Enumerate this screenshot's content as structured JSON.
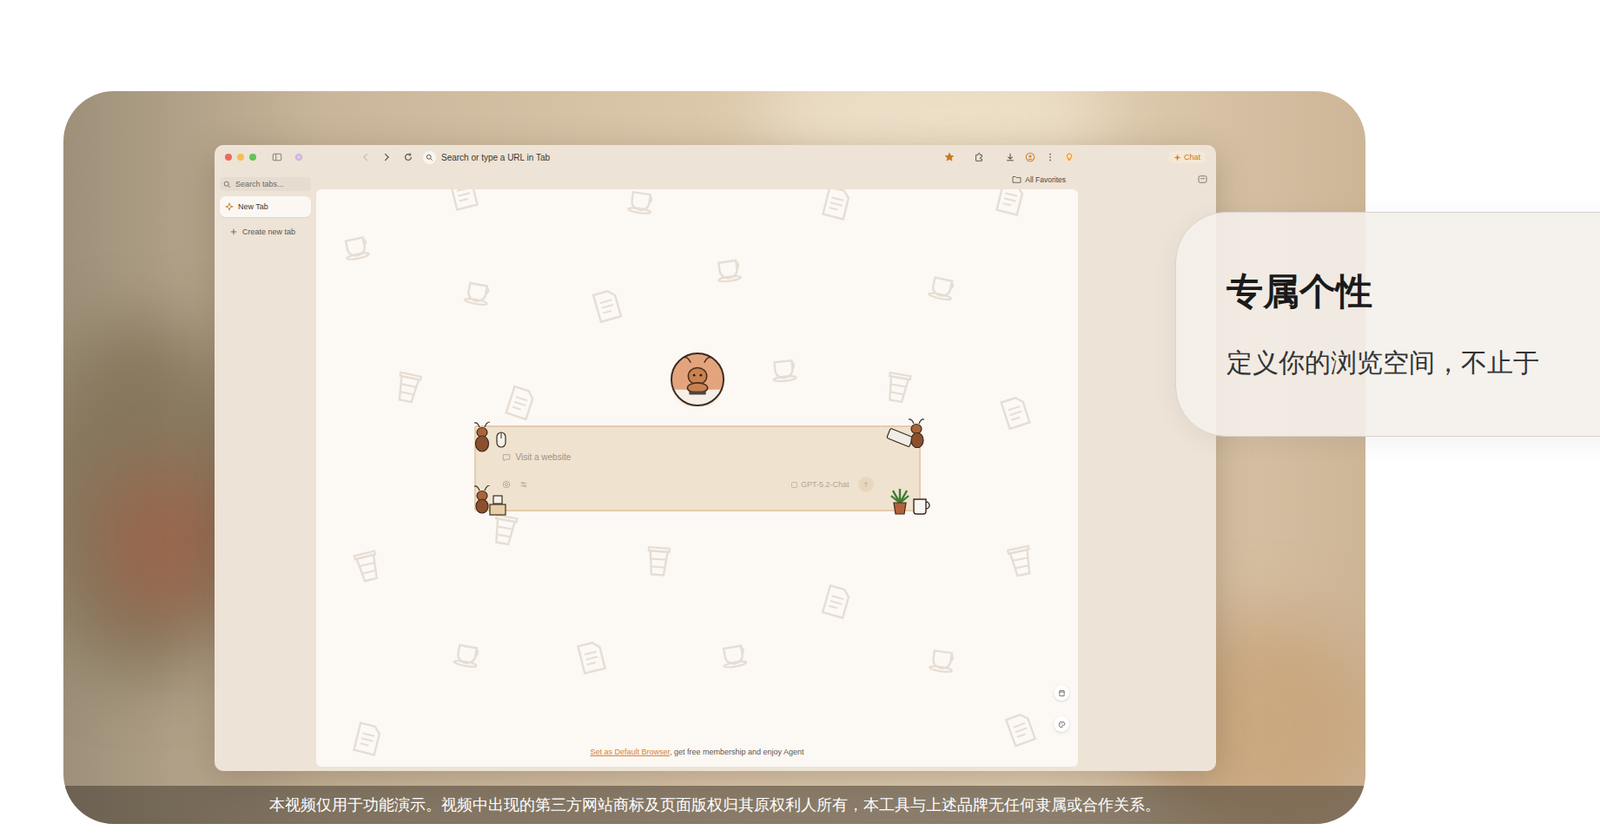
{
  "feature_card": {
    "title": "专属个性",
    "subtitle": "定义你的浏览空间，不止于"
  },
  "caption": "本视频仅用于功能演示。视频中出现的第三方网站商标及页面版权归其原权利人所有，本工具与上述品牌无任何隶属或合作关系。",
  "browser": {
    "address_placeholder": "Search or type a URL in Tab",
    "starred": true,
    "chat_button": "Chat",
    "favorites": "All Favorites",
    "sidebar": {
      "search_placeholder": "Search tabs...",
      "tabs": [
        {
          "label": "New Tab",
          "selected": true
        }
      ],
      "create": "Create new tab"
    },
    "composer": {
      "placeholder": "Visit a website",
      "model": "GPT-5.2-Chat"
    },
    "footer": {
      "link": "Set as Default Browser",
      "text": ", get free membership and enjoy Agent"
    }
  }
}
